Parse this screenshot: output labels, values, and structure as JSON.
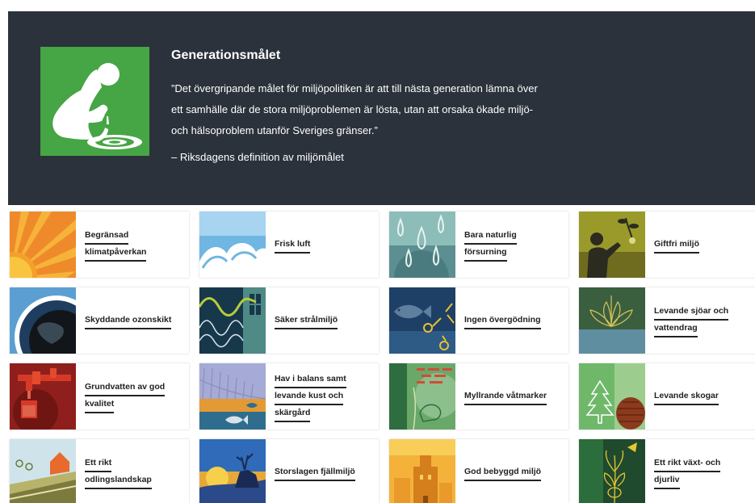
{
  "hero": {
    "title": "Generationsmålet",
    "quote_lines": [
      "”Det övergripande målet för miljöpolitiken är att till nästa generation lämna över",
      "ett samhälle där de stora miljöproblemen är lösta, utan att orsaka ökade miljö-",
      "och hälsoproblem utanför Sveriges gränser.”"
    ],
    "attribution": "– Riksdagens definition av miljömålet",
    "icon": "boy-drinking-water-icon",
    "icon_color": "#46a544"
  },
  "goals": [
    {
      "lines": [
        "Begränsad",
        "klimatpåverkan"
      ],
      "icon": "sun-icon"
    },
    {
      "lines": [
        "Frisk luft",
        ""
      ],
      "icon": "clouds-icon"
    },
    {
      "lines": [
        "Bara naturlig",
        "försurning"
      ],
      "icon": "raindrops-icon"
    },
    {
      "lines": [
        "Giftfri miljö",
        ""
      ],
      "icon": "person-plant-icon"
    },
    {
      "lines": [
        "Skyddande ozonskikt",
        ""
      ],
      "icon": "earth-ozone-icon"
    },
    {
      "lines": [
        "Säker strålmiljö",
        ""
      ],
      "icon": "radiation-waves-icon"
    },
    {
      "lines": [
        "Ingen övergödning",
        ""
      ],
      "icon": "fish-icon"
    },
    {
      "lines": [
        "Levande sjöar och",
        "vattendrag"
      ],
      "icon": "water-lily-icon"
    },
    {
      "lines": [
        "Grundvatten av god",
        "kvalitet"
      ],
      "icon": "water-tap-icon"
    },
    {
      "lines": [
        "Hav i balans samt",
        "levande kust och",
        "skärgård"
      ],
      "icon": "boat-fish-icon"
    },
    {
      "lines": [
        "Myllrande våtmarker",
        ""
      ],
      "icon": "frog-icon"
    },
    {
      "lines": [
        "Levande skogar",
        ""
      ],
      "icon": "pine-tree-icon"
    },
    {
      "lines": [
        "Ett rikt",
        "odlingslandskap"
      ],
      "icon": "farmland-icon"
    },
    {
      "lines": [
        "Storslagen fjällmiljö",
        ""
      ],
      "icon": "reindeer-mountain-icon"
    },
    {
      "lines": [
        "God bebyggd miljö",
        ""
      ],
      "icon": "buildings-icon"
    },
    {
      "lines": [
        "Ett rikt växt- och",
        "djurliv"
      ],
      "icon": "orchid-icon"
    }
  ]
}
